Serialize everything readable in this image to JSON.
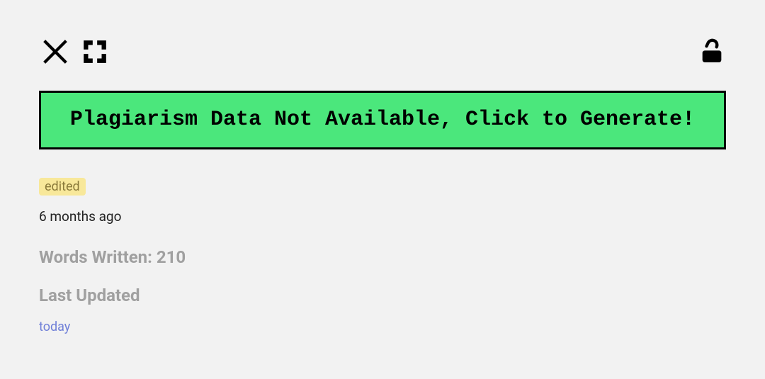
{
  "banner": {
    "text": "Plagiarism Data Not Available, Click to Generate!"
  },
  "badge": {
    "label": "edited"
  },
  "timestamp": "6 months ago",
  "stats": {
    "words_written": "Words Written: 210",
    "last_updated_label": "Last Updated",
    "last_updated_value": "today"
  }
}
